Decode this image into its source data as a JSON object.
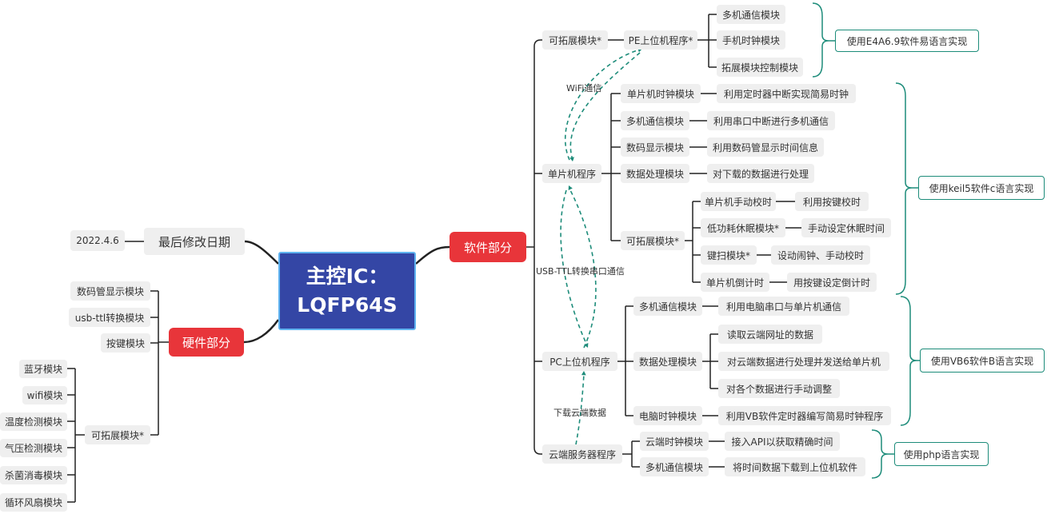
{
  "colors": {
    "accent": "#1d8c7a",
    "root": "#3446a5",
    "main": "#e8353a",
    "node": "#efefef"
  },
  "root": {
    "line1": "主控IC：",
    "line2": "LQFP64S"
  },
  "left": {
    "date_label": "最后修改日期",
    "date_value": "2022.4.6",
    "hardware": {
      "label": "硬件部分",
      "items": [
        "数码管显示模块",
        "usb-ttl转换模块",
        "按键模块"
      ],
      "expandable": {
        "label": "可拓展模块*",
        "items": [
          "蓝牙模块",
          "wifi模块",
          "温度检测模块",
          "气压检测模块",
          "杀菌消毒模块",
          "循环风扇模块"
        ]
      }
    }
  },
  "software": {
    "label": "软件部分",
    "ext": {
      "label": "可拓展模块*",
      "pe": {
        "label": "PE上位机程序*",
        "items": [
          "多机通信模块",
          "手机时钟模块",
          "拓展模块控制模块"
        ]
      },
      "summary": "使用E4A6.9软件易语言实现"
    },
    "mcu": {
      "label": "单片机程序",
      "modules": [
        {
          "label": "单片机时钟模块",
          "desc": "利用定时器中断实现简易时钟"
        },
        {
          "label": "多机通信模块",
          "desc": "利用串口中断进行多机通信"
        },
        {
          "label": "数码显示模块",
          "desc": "利用数码管显示时间信息"
        },
        {
          "label": "数据处理模块",
          "desc": "对下载的数据进行处理"
        }
      ],
      "ext": {
        "label": "可拓展模块*",
        "items": [
          {
            "label": "单片机手动校时",
            "desc": "利用按键校时"
          },
          {
            "label": "低功耗休眠模块*",
            "desc": "手动设定休眠时间"
          },
          {
            "label": "键扫模块*",
            "desc": "设动闹钟、手动校时"
          },
          {
            "label": "单片机倒计时",
            "desc": "用按键设定倒计时"
          }
        ]
      },
      "summary": "使用keil5软件c语言实现"
    },
    "pc": {
      "label": "PC上位机程序",
      "comm": {
        "label": "多机通信模块",
        "desc": "利用电脑串口与单片机通信"
      },
      "data": {
        "label": "数据处理模块",
        "items": [
          "读取云端网址的数据",
          "对云端数据进行处理并发送给单片机",
          "对各个数据进行手动调整"
        ]
      },
      "clock": {
        "label": "电脑时钟模块",
        "desc": "利用VB软件定时器编写简易时钟程序"
      },
      "summary": "使用VB6软件B语言实现"
    },
    "cloud": {
      "label": "云端服务器程序",
      "items": [
        {
          "label": "云端时钟模块",
          "desc": "接入API以获取精确时间"
        },
        {
          "label": "多机通信模块",
          "desc": "将时间数据下载到上位机软件"
        }
      ],
      "summary": "使用php语言实现"
    },
    "annotations": {
      "wifi": "WiFi通信",
      "usb": "USB-TTL转换串口通信",
      "download": "下载云端数据"
    }
  }
}
